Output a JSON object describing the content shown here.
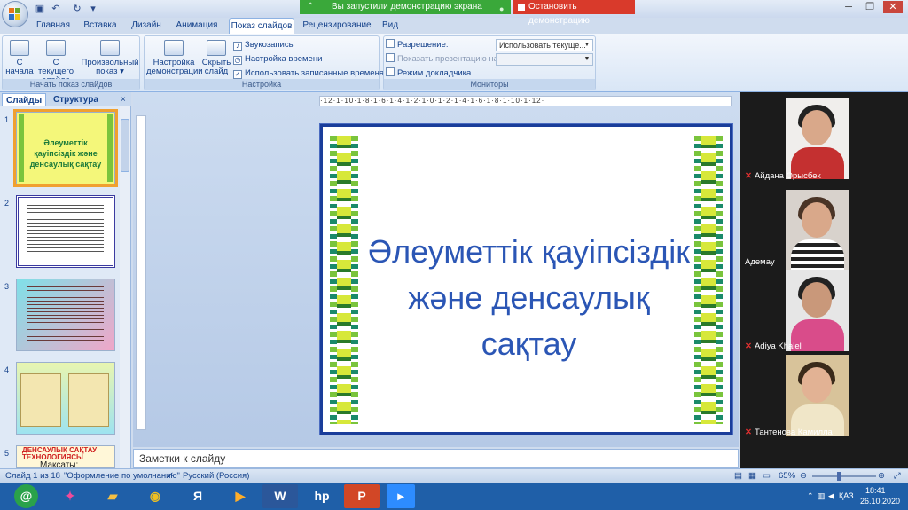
{
  "titlebar": {
    "share_message": "Вы запустили демонстрацию экрана",
    "stop_share": "Остановить демонстрацию"
  },
  "tabs": [
    "Главная",
    "Вставка",
    "Дизайн",
    "Анимация",
    "Показ слайдов",
    "Рецензирование",
    "Вид"
  ],
  "ribbon": {
    "start_group": {
      "label": "Начать показ слайдов",
      "from_start": "С начала",
      "from_current": "С текущего слайда",
      "custom_show": "Произвольный показ"
    },
    "setup_group": {
      "label": "Настройка",
      "setup_show": "Настройка демонстрации",
      "hide_slide": "Скрыть слайд",
      "record_narration": "Звукозапись",
      "rehearse_timings": "Настройка времени",
      "use_timings": "Использовать записанные времена"
    },
    "monitors_group": {
      "label": "Мониторы",
      "resolution_label": "Разрешение:",
      "resolution_value": "Использовать текуще...",
      "show_on_label": "Показать презентацию на:",
      "presenter_view": "Режим докладчика"
    }
  },
  "slides_pane": {
    "tab_slides": "Слайды",
    "tab_outline": "Структура",
    "numbers": [
      "1",
      "2",
      "3",
      "4",
      "5"
    ],
    "thumb1_title": "Әлеуметтік қауіпсіздік және денсаулық сақтау",
    "thumb5_title": "ДЕНСАУЛЫҚ САҚТАУ ТЕХНОЛОГИЯСЫ",
    "thumb5_sub": "Мақсаты:"
  },
  "slide": {
    "title_line1": "Әлеуметтік қауіпсіздік",
    "title_line2": "және денсаулық сақтау"
  },
  "ruler": "·12·1·10·1·8·1·6·1·4·1·2·1·0·1·2·1·4·1·6·1·8·1·10·1·12·",
  "notes_placeholder": "Заметки к слайду",
  "participants": [
    "Айдана Орысбек",
    "Адемау",
    "Adiya Khalel",
    "Тантенова Камилла"
  ],
  "statusbar": {
    "slide_info": "Слайд 1 из 18",
    "theme": "\"Оформление по умолчанию\"",
    "language": "Русский (Россия)",
    "zoom": "65%"
  },
  "taskbar": {
    "lang": "ҚАЗ",
    "time": "18:41",
    "date": "26.10.2020"
  },
  "colors": {
    "ribbon_bg": "#dbe7f6",
    "slide_title": "#2b56b5",
    "share_green": "#3aa83a",
    "stop_red": "#d93a2b",
    "taskbar": "#1f5fa8"
  }
}
